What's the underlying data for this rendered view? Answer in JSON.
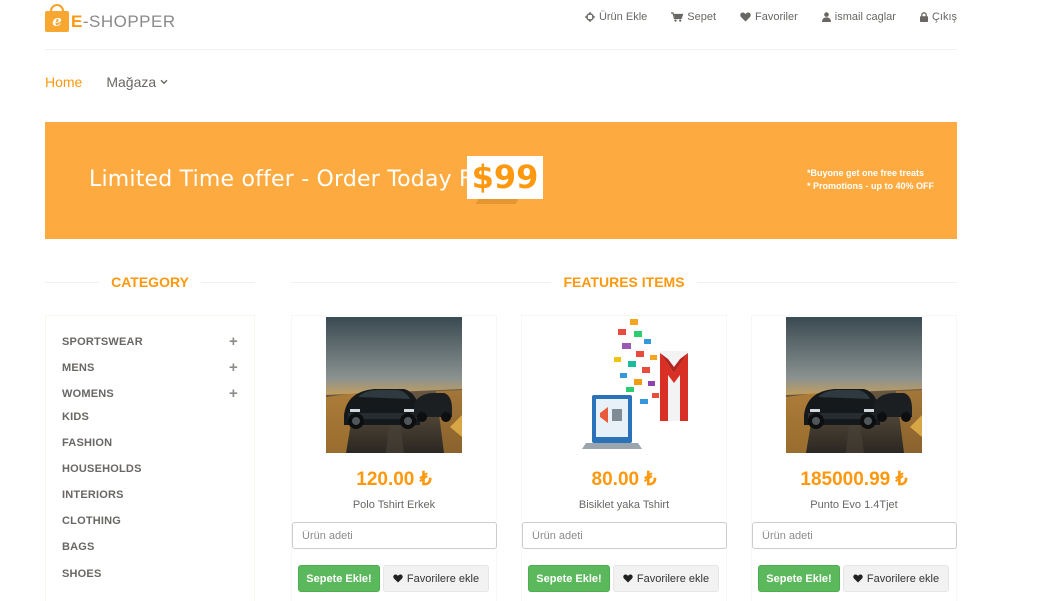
{
  "brand": {
    "logo_letter": "e",
    "name_accent": "E",
    "name_rest": "-SHOPPER"
  },
  "shop_menu": [
    {
      "icon": "crosshair-icon",
      "label": "Ürün Ekle"
    },
    {
      "icon": "cart-icon",
      "label": "Sepet"
    },
    {
      "icon": "heart-icon",
      "label": "Favoriler"
    },
    {
      "icon": "user-icon",
      "label": "ismail caglar"
    },
    {
      "icon": "lock-icon",
      "label": "Çıkış"
    }
  ],
  "main_nav": {
    "home": "Home",
    "shop": "Mağaza"
  },
  "banner": {
    "text": "Limited Time offer - Order Today For",
    "price": "$99",
    "note1": "*Buyone get one free treats",
    "note2": "* Promotions - up to 40% OFF"
  },
  "category": {
    "title": "CATEGORY",
    "items": [
      {
        "label": "SPORTSWEAR",
        "expand": "+"
      },
      {
        "label": "MENS",
        "expand": "+"
      },
      {
        "label": "WOMENS",
        "expand": "+"
      },
      {
        "label": "KIDS"
      },
      {
        "label": "FASHION"
      },
      {
        "label": "HOUSEHOLDS"
      },
      {
        "label": "INTERIORS"
      },
      {
        "label": "CLOTHING"
      },
      {
        "label": "BAGS"
      },
      {
        "label": "SHOES"
      }
    ]
  },
  "features": {
    "title": "FEATURES ITEMS",
    "products": [
      {
        "image": "car-photo",
        "price": "120.00 ₺",
        "name": "Polo Tshirt Erkek",
        "qty_placeholder": "Ürün adeti",
        "cart_label": "Sepete Ekle!",
        "fav_label": "Favorilere ekle"
      },
      {
        "image": "gmail-illustration",
        "price": "80.00 ₺",
        "name": "Bisiklet yaka Tshirt",
        "qty_placeholder": "Ürün adeti",
        "cart_label": "Sepete Ekle!",
        "fav_label": "Favorilere ekle"
      },
      {
        "image": "car-photo",
        "price": "185000.99 ₺",
        "name": "Punto Evo 1.4Tjet",
        "qty_placeholder": "Ürün adeti",
        "cart_label": "Sepete Ekle!",
        "fav_label": "Favorilere ekle"
      }
    ]
  },
  "colors": {
    "accent": "#fe980f",
    "banner": "#fdab40",
    "cart_button": "#5cb85c"
  }
}
